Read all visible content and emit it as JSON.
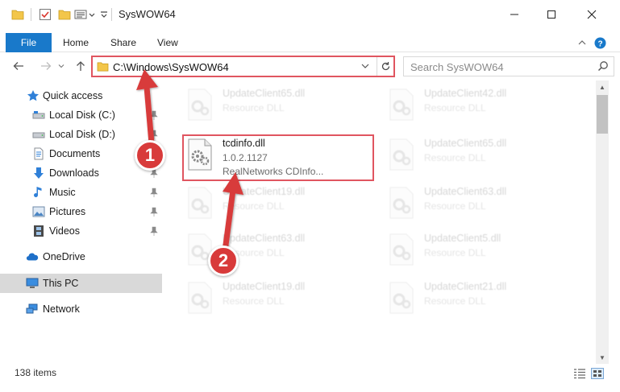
{
  "window": {
    "title": "SysWOW64"
  },
  "ribbon": {
    "tabs": [
      "File",
      "Home",
      "Share",
      "View"
    ]
  },
  "address": {
    "path": "C:\\Windows\\SysWOW64"
  },
  "search": {
    "placeholder": "Search SysWOW64"
  },
  "nav": {
    "items": [
      {
        "label": "Quick access"
      },
      {
        "label": "Local Disk (C:)"
      },
      {
        "label": "Local Disk (D:)"
      },
      {
        "label": "Documents"
      },
      {
        "label": "Downloads"
      },
      {
        "label": "Music"
      },
      {
        "label": "Pictures"
      },
      {
        "label": "Videos"
      },
      {
        "label": "OneDrive"
      },
      {
        "label": "This PC"
      },
      {
        "label": "Network"
      }
    ]
  },
  "files": [
    {
      "name": "UpdateClient65.dll",
      "type": "Resource DLL"
    },
    {
      "name": "UpdateClient42.dll",
      "type": "Resource DLL"
    },
    {
      "name": "tcdinfo.dll",
      "version": "1.0.2.1127",
      "desc": "RealNetworks CDInfo..."
    },
    {
      "name": "UpdateClient65.dll",
      "type": "Resource DLL"
    },
    {
      "name": "UpdateClient19.dll",
      "type": "Resource DLL"
    },
    {
      "name": "UpdateClient63.dll",
      "type": "Resource DLL"
    },
    {
      "name": "UpdateClient63.dll",
      "type": "Resource DLL"
    },
    {
      "name": "UpdateClient5.dll",
      "type": "Resource DLL"
    },
    {
      "name": "UpdateClient19.dll",
      "type": "Resource DLL"
    },
    {
      "name": "UpdateClient21.dll",
      "type": "Resource DLL"
    }
  ],
  "status": {
    "count": "138 items"
  },
  "annotations": {
    "badge1": "1",
    "badge2": "2",
    "color": "#d83a3a"
  },
  "colors": {
    "accent": "#1979ca",
    "highlight_border": "#e05560"
  }
}
